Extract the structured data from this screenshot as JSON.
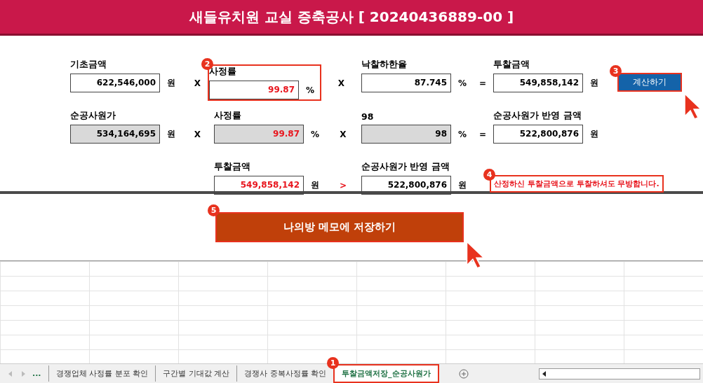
{
  "title": "새들유치원 교실 증축공사 [ 20240436889-00 ]",
  "rows": [
    {
      "cells": [
        {
          "kind": "field",
          "label": "기초금액",
          "value": "622,546,000",
          "unit": "원",
          "operator": "X",
          "readonly": false,
          "emphasis": false
        },
        {
          "kind": "field",
          "label": "사정률",
          "value": "99.87",
          "unit": "%",
          "operator": "X",
          "readonly": false,
          "emphasis": true,
          "callout": "2"
        },
        {
          "kind": "field",
          "label": "낙찰하한율",
          "value": "87.745",
          "unit": "%",
          "operator": "=",
          "readonly": false,
          "emphasis": false
        },
        {
          "kind": "field",
          "label": "투찰금액",
          "value": "549,858,142",
          "unit": "원",
          "readonly": false,
          "emphasis": false
        },
        {
          "kind": "button",
          "label": "계산하기",
          "callout": "3",
          "pointer": true
        }
      ]
    },
    {
      "cells": [
        {
          "kind": "field",
          "label": "순공사원가",
          "value": "534,164,695",
          "unit": "원",
          "operator": "X",
          "readonly": true,
          "emphasis": false
        },
        {
          "kind": "field",
          "label": "사정률",
          "value": "99.87",
          "unit": "%",
          "operator": "X",
          "readonly": true,
          "emphasis": true
        },
        {
          "kind": "field",
          "label": "98",
          "value": "98",
          "unit": "%",
          "operator": "=",
          "readonly": true,
          "emphasis": false
        },
        {
          "kind": "field",
          "label": "순공사원가 반영 금액",
          "value": "522,800,876",
          "unit": "원",
          "readonly": false,
          "emphasis": false
        }
      ]
    },
    {
      "cells": [
        {
          "kind": "blank"
        },
        {
          "kind": "field",
          "label": "투찰금액",
          "value": "549,858,142",
          "unit": "원",
          "operator": ">",
          "operator_emphasis": true,
          "readonly": false,
          "emphasis": true
        },
        {
          "kind": "field",
          "label": "순공사원가 반영 금액",
          "value": "522,800,876",
          "unit": "원",
          "readonly": false,
          "emphasis": false
        },
        {
          "kind": "notice",
          "text": "산정하신 투찰금액으로 투찰하셔도 무방합니다.",
          "callout": "4"
        }
      ]
    }
  ],
  "save_button": {
    "label": "나의방 메모에 저장하기",
    "callout": "5",
    "pointer": true
  },
  "sheet_tabs": {
    "overflow": "...",
    "tabs": [
      {
        "label": "경쟁업체 사정률 분포 확인",
        "selected": false
      },
      {
        "label": "구간별 기대값 계산",
        "selected": false
      },
      {
        "label": "경쟁사 중복사정률 확인",
        "selected": false
      },
      {
        "label": "투찰금액저장_순공사원가",
        "selected": true,
        "callout": "1"
      }
    ]
  }
}
